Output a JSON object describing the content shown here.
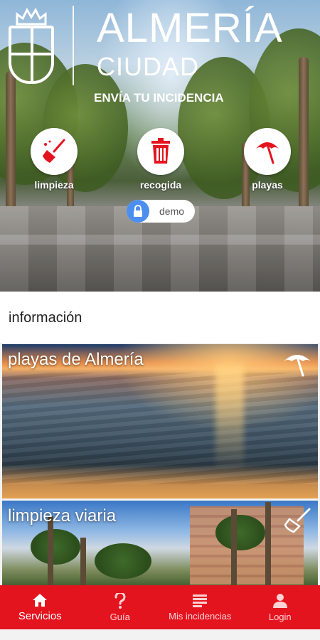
{
  "header": {
    "title": "ALMERÍA",
    "subtitle": "CIUDAD",
    "cta": "ENVÍA TU INCIDENCIA"
  },
  "services": [
    {
      "label": "limpieza",
      "icon": "broom-icon"
    },
    {
      "label": "recogida",
      "icon": "trash-bin-icon"
    },
    {
      "label": "playas",
      "icon": "beach-umbrella-icon"
    }
  ],
  "demo": {
    "label": "demo",
    "icon": "lock-icon"
  },
  "info": {
    "title": "información",
    "cards": [
      {
        "title": "playas de Almería",
        "icon": "beach-umbrella-icon"
      },
      {
        "title": "limpieza viaria",
        "icon": "broom-icon"
      }
    ]
  },
  "nav": {
    "items": [
      {
        "label": "Servicios",
        "icon": "home-icon",
        "active": true
      },
      {
        "label": "Guía",
        "icon": "question-icon",
        "active": false
      },
      {
        "label": "Mis incidencias",
        "icon": "list-icon",
        "active": false
      },
      {
        "label": "Login",
        "icon": "user-icon",
        "active": false
      }
    ]
  },
  "colors": {
    "accent": "#e4141f",
    "demo_lock": "#4c8ef0"
  }
}
